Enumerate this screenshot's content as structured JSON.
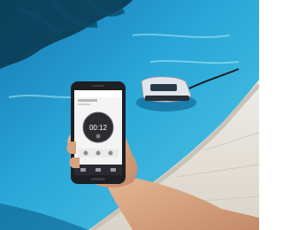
{
  "scene": {
    "subject": "robotic-pool-cleaner",
    "device": "smartphone",
    "phone_app": {
      "timer_display": "00:12"
    },
    "colors": {
      "pool_water": "#2aa8d8",
      "pool_deep": "#0f7fb8",
      "deck": "#e8e4dc",
      "phone_body": "#1e1f24",
      "screen_bg": "#f4f4f4",
      "dial_dark": "#2b2c30",
      "skin": "#d7a583"
    }
  }
}
